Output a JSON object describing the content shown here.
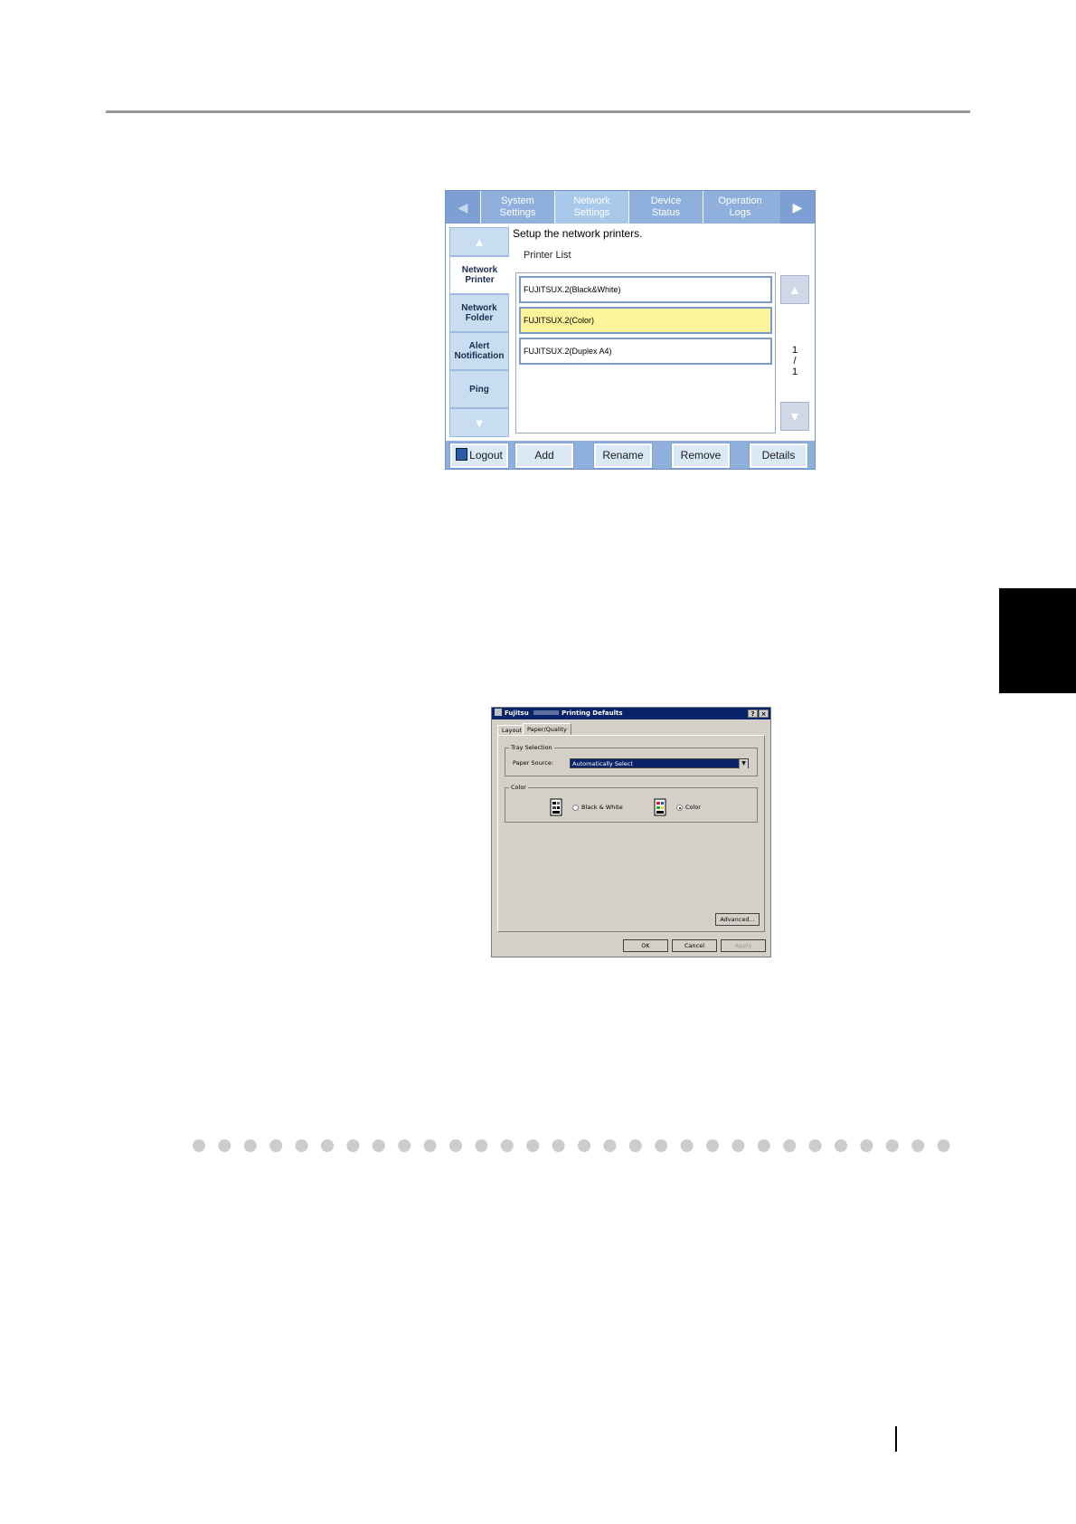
{
  "panel": {
    "tabs": [
      {
        "line1": "System",
        "line2": "Settings"
      },
      {
        "line1": "Network",
        "line2": "Settings"
      },
      {
        "line1": "Device",
        "line2": "Status"
      },
      {
        "line1": "Operation",
        "line2": "Logs"
      }
    ],
    "side_items": [
      {
        "line1": "Network",
        "line2": "Printer"
      },
      {
        "line1": "Network",
        "line2": "Folder"
      },
      {
        "line1": "Alert",
        "line2": "Notification"
      },
      {
        "line1": "Ping",
        "line2": ""
      }
    ],
    "instruction": "Setup the network printers.",
    "list_title": "Printer List",
    "printers": [
      "FUJITSUX.2(Black&White)",
      "FUJITSUX.2(Color)",
      "FUJITSUX.2(Duplex A4)"
    ],
    "page_current": "1",
    "page_sep": "/",
    "page_total": "1",
    "buttons": {
      "logout": "Logout",
      "add": "Add",
      "rename": "Rename",
      "remove": "Remove",
      "details": "Details"
    }
  },
  "dialog": {
    "title_brand": "Fujitsu",
    "title_rest": "Printing Defaults",
    "help_btn": "?",
    "close_btn": "×",
    "tabs": [
      "Layout",
      "Paper/Quality"
    ],
    "tray_group": "Tray Selection",
    "paper_source_label": "Paper Source:",
    "paper_source_value": "Automatically Select",
    "color_group": "Color",
    "bw_label": "Black & White",
    "color_label": "Color",
    "advanced": "Advanced...",
    "ok": "OK",
    "cancel": "Cancel",
    "apply": "Apply"
  }
}
